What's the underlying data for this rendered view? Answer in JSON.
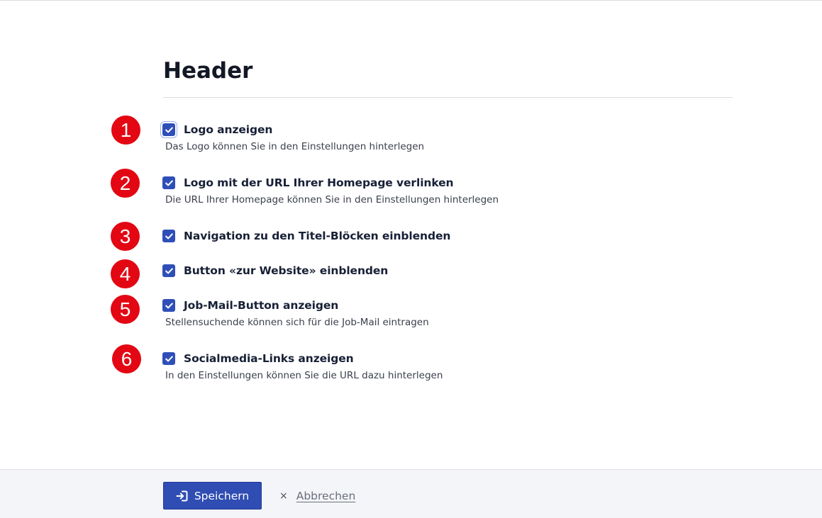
{
  "header": {
    "title": "Header"
  },
  "options": [
    {
      "badge": "1",
      "label": "Logo anzeigen",
      "description": "Das Logo können Sie in den Einstellungen hinterlegen",
      "checked": true
    },
    {
      "badge": "2",
      "label": "Logo mit der URL Ihrer Homepage verlinken",
      "description": "Die URL Ihrer Homepage können Sie in den Einstellungen hinterlegen",
      "checked": true
    },
    {
      "badge": "3",
      "label": "Navigation zu den Titel-Blöcken einblenden",
      "description": "",
      "checked": true
    },
    {
      "badge": "4",
      "label": "Button «zur Website» einblenden",
      "description": "",
      "checked": true
    },
    {
      "badge": "5",
      "label": "Job-Mail-Button anzeigen",
      "description": "Stellensuchende können sich für die Job-Mail eintragen",
      "checked": true
    },
    {
      "badge": "6",
      "label": "Socialmedia-Links anzeigen",
      "description": "In den Einstellungen können Sie die URL dazu hinterlegen",
      "checked": true
    }
  ],
  "footer": {
    "save_label": "Speichern",
    "cancel_symbol": "×",
    "cancel_label": "Abbrechen"
  },
  "icons": {
    "checkbox": "check-icon",
    "save": "sign-in-icon",
    "cancel": "close-icon"
  },
  "colors": {
    "accent": "#2f4fb8",
    "badge": "#e30613",
    "footer_bg": "#f4f5f8"
  }
}
